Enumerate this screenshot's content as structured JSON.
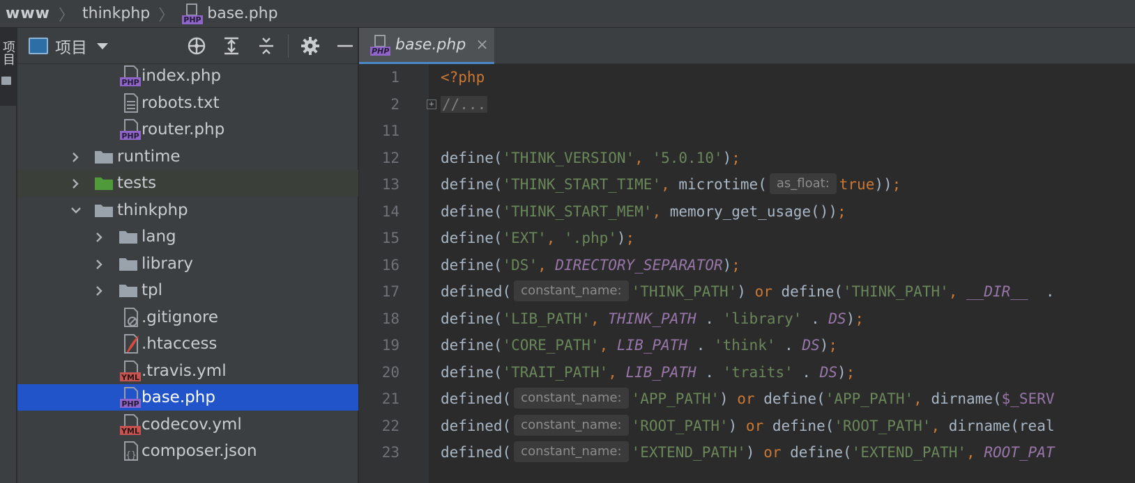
{
  "breadcrumb": {
    "items": [
      "www",
      "thinkphp",
      "base.php"
    ]
  },
  "toolstrip": {
    "tab_label": "项目"
  },
  "project_panel": {
    "title": "项目",
    "tools": [
      "locate-icon",
      "expand-all-icon",
      "collapse-all-icon",
      "gear-icon",
      "minimize-icon"
    ],
    "tree": [
      {
        "label": "index.php",
        "kind": "php"
      },
      {
        "label": "robots.txt",
        "kind": "txt"
      },
      {
        "label": "router.php",
        "kind": "php"
      },
      {
        "label": "runtime",
        "kind": "folder",
        "expanded": false
      },
      {
        "label": "tests",
        "kind": "folder-green",
        "expanded": false,
        "highlight": true
      },
      {
        "label": "thinkphp",
        "kind": "folder",
        "expanded": true
      },
      {
        "label": "lang",
        "kind": "folder",
        "expanded": false
      },
      {
        "label": "library",
        "kind": "folder",
        "expanded": false
      },
      {
        "label": "tpl",
        "kind": "folder",
        "expanded": false
      },
      {
        "label": ".gitignore",
        "kind": "gitignore"
      },
      {
        "label": ".htaccess",
        "kind": "htaccess"
      },
      {
        "label": ".travis.yml",
        "kind": "yml"
      },
      {
        "label": "base.php",
        "kind": "php",
        "selected": true
      },
      {
        "label": "codecov.yml",
        "kind": "yml"
      },
      {
        "label": "composer.json",
        "kind": "json"
      }
    ]
  },
  "editor": {
    "tab_label": "base.php",
    "line_numbers": [
      "1",
      "2",
      "11",
      "12",
      "13",
      "14",
      "15",
      "16",
      "17",
      "18",
      "19",
      "20",
      "21",
      "22",
      "23"
    ],
    "lines": [
      {
        "tokens": [
          {
            "t": "tag",
            "v": "<?php"
          }
        ]
      },
      {
        "tokens": [
          {
            "t": "comment",
            "v": "//..."
          }
        ]
      },
      {
        "tokens": []
      },
      {
        "tokens": [
          {
            "t": "fn",
            "v": "define"
          },
          {
            "t": "paren",
            "v": "("
          },
          {
            "t": "str",
            "v": "'THINK_VERSION'"
          },
          {
            "t": "punct",
            "v": ", "
          },
          {
            "t": "str",
            "v": "'5.0.10'"
          },
          {
            "t": "paren",
            "v": ")"
          },
          {
            "t": "punct",
            "v": ";"
          }
        ]
      },
      {
        "tokens": [
          {
            "t": "fn",
            "v": "define"
          },
          {
            "t": "paren",
            "v": "("
          },
          {
            "t": "str",
            "v": "'THINK_START_TIME'"
          },
          {
            "t": "punct",
            "v": ", "
          },
          {
            "t": "fn",
            "v": "microtime"
          },
          {
            "t": "paren",
            "v": "("
          },
          {
            "t": "hint",
            "v": "as_float:"
          },
          {
            "t": "kw",
            "v": "true"
          },
          {
            "t": "paren",
            "v": "))"
          },
          {
            "t": "punct",
            "v": ";"
          }
        ]
      },
      {
        "tokens": [
          {
            "t": "fn",
            "v": "define"
          },
          {
            "t": "paren",
            "v": "("
          },
          {
            "t": "str",
            "v": "'THINK_START_MEM'"
          },
          {
            "t": "punct",
            "v": ", "
          },
          {
            "t": "fn",
            "v": "memory_get_usage"
          },
          {
            "t": "paren",
            "v": "())"
          },
          {
            "t": "punct",
            "v": ";"
          }
        ]
      },
      {
        "tokens": [
          {
            "t": "fn",
            "v": "define"
          },
          {
            "t": "paren",
            "v": "("
          },
          {
            "t": "str",
            "v": "'EXT'"
          },
          {
            "t": "punct",
            "v": ", "
          },
          {
            "t": "str",
            "v": "'.php'"
          },
          {
            "t": "paren",
            "v": ")"
          },
          {
            "t": "punct",
            "v": ";"
          }
        ]
      },
      {
        "tokens": [
          {
            "t": "fn",
            "v": "define"
          },
          {
            "t": "paren",
            "v": "("
          },
          {
            "t": "str",
            "v": "'DS'"
          },
          {
            "t": "punct",
            "v": ", "
          },
          {
            "t": "const",
            "v": "DIRECTORY_SEPARATOR"
          },
          {
            "t": "paren",
            "v": ")"
          },
          {
            "t": "punct",
            "v": ";"
          }
        ]
      },
      {
        "tokens": [
          {
            "t": "fn",
            "v": "defined"
          },
          {
            "t": "paren",
            "v": "("
          },
          {
            "t": "hint",
            "v": "constant_name:"
          },
          {
            "t": "str",
            "v": "'THINK_PATH'"
          },
          {
            "t": "paren",
            "v": ") "
          },
          {
            "t": "kw",
            "v": "or "
          },
          {
            "t": "fn",
            "v": "define"
          },
          {
            "t": "paren",
            "v": "("
          },
          {
            "t": "str",
            "v": "'THINK_PATH'"
          },
          {
            "t": "punct",
            "v": ", "
          },
          {
            "t": "const",
            "v": "__DIR__"
          },
          {
            "t": "paren",
            "v": "  ."
          }
        ]
      },
      {
        "tokens": [
          {
            "t": "fn",
            "v": "define"
          },
          {
            "t": "paren",
            "v": "("
          },
          {
            "t": "str",
            "v": "'LIB_PATH'"
          },
          {
            "t": "punct",
            "v": ", "
          },
          {
            "t": "const",
            "v": "THINK_PATH"
          },
          {
            "t": "paren",
            "v": " . "
          },
          {
            "t": "str",
            "v": "'library'"
          },
          {
            "t": "paren",
            "v": " . "
          },
          {
            "t": "const",
            "v": "DS"
          },
          {
            "t": "paren",
            "v": ")"
          },
          {
            "t": "punct",
            "v": ";"
          }
        ]
      },
      {
        "tokens": [
          {
            "t": "fn",
            "v": "define"
          },
          {
            "t": "paren",
            "v": "("
          },
          {
            "t": "str",
            "v": "'CORE_PATH'"
          },
          {
            "t": "punct",
            "v": ", "
          },
          {
            "t": "const",
            "v": "LIB_PATH"
          },
          {
            "t": "paren",
            "v": " . "
          },
          {
            "t": "str",
            "v": "'think'"
          },
          {
            "t": "paren",
            "v": " . "
          },
          {
            "t": "const",
            "v": "DS"
          },
          {
            "t": "paren",
            "v": ")"
          },
          {
            "t": "punct",
            "v": ";"
          }
        ]
      },
      {
        "tokens": [
          {
            "t": "fn",
            "v": "define"
          },
          {
            "t": "paren",
            "v": "("
          },
          {
            "t": "str",
            "v": "'TRAIT_PATH'"
          },
          {
            "t": "punct",
            "v": ", "
          },
          {
            "t": "const",
            "v": "LIB_PATH"
          },
          {
            "t": "paren",
            "v": " . "
          },
          {
            "t": "str",
            "v": "'traits'"
          },
          {
            "t": "paren",
            "v": " . "
          },
          {
            "t": "const",
            "v": "DS"
          },
          {
            "t": "paren",
            "v": ")"
          },
          {
            "t": "punct",
            "v": ";"
          }
        ]
      },
      {
        "tokens": [
          {
            "t": "fn",
            "v": "defined"
          },
          {
            "t": "paren",
            "v": "("
          },
          {
            "t": "hint",
            "v": "constant_name:"
          },
          {
            "t": "str",
            "v": "'APP_PATH'"
          },
          {
            "t": "paren",
            "v": ") "
          },
          {
            "t": "kw",
            "v": "or "
          },
          {
            "t": "fn",
            "v": "define"
          },
          {
            "t": "paren",
            "v": "("
          },
          {
            "t": "str",
            "v": "'APP_PATH'"
          },
          {
            "t": "punct",
            "v": ", "
          },
          {
            "t": "fn",
            "v": "dirname"
          },
          {
            "t": "paren",
            "v": "("
          },
          {
            "t": "var",
            "v": "$_SERV"
          }
        ]
      },
      {
        "tokens": [
          {
            "t": "fn",
            "v": "defined"
          },
          {
            "t": "paren",
            "v": "("
          },
          {
            "t": "hint",
            "v": "constant_name:"
          },
          {
            "t": "str",
            "v": "'ROOT_PATH'"
          },
          {
            "t": "paren",
            "v": ") "
          },
          {
            "t": "kw",
            "v": "or "
          },
          {
            "t": "fn",
            "v": "define"
          },
          {
            "t": "paren",
            "v": "("
          },
          {
            "t": "str",
            "v": "'ROOT_PATH'"
          },
          {
            "t": "punct",
            "v": ", "
          },
          {
            "t": "fn",
            "v": "dirname"
          },
          {
            "t": "paren",
            "v": "(real"
          }
        ]
      },
      {
        "tokens": [
          {
            "t": "fn",
            "v": "defined"
          },
          {
            "t": "paren",
            "v": "("
          },
          {
            "t": "hint",
            "v": "constant_name:"
          },
          {
            "t": "str",
            "v": "'EXTEND_PATH'"
          },
          {
            "t": "paren",
            "v": ") "
          },
          {
            "t": "kw",
            "v": "or "
          },
          {
            "t": "fn",
            "v": "define"
          },
          {
            "t": "paren",
            "v": "("
          },
          {
            "t": "str",
            "v": "'EXTEND_PATH'"
          },
          {
            "t": "punct",
            "v": ", "
          },
          {
            "t": "const",
            "v": "ROOT_PAT"
          }
        ]
      }
    ]
  }
}
